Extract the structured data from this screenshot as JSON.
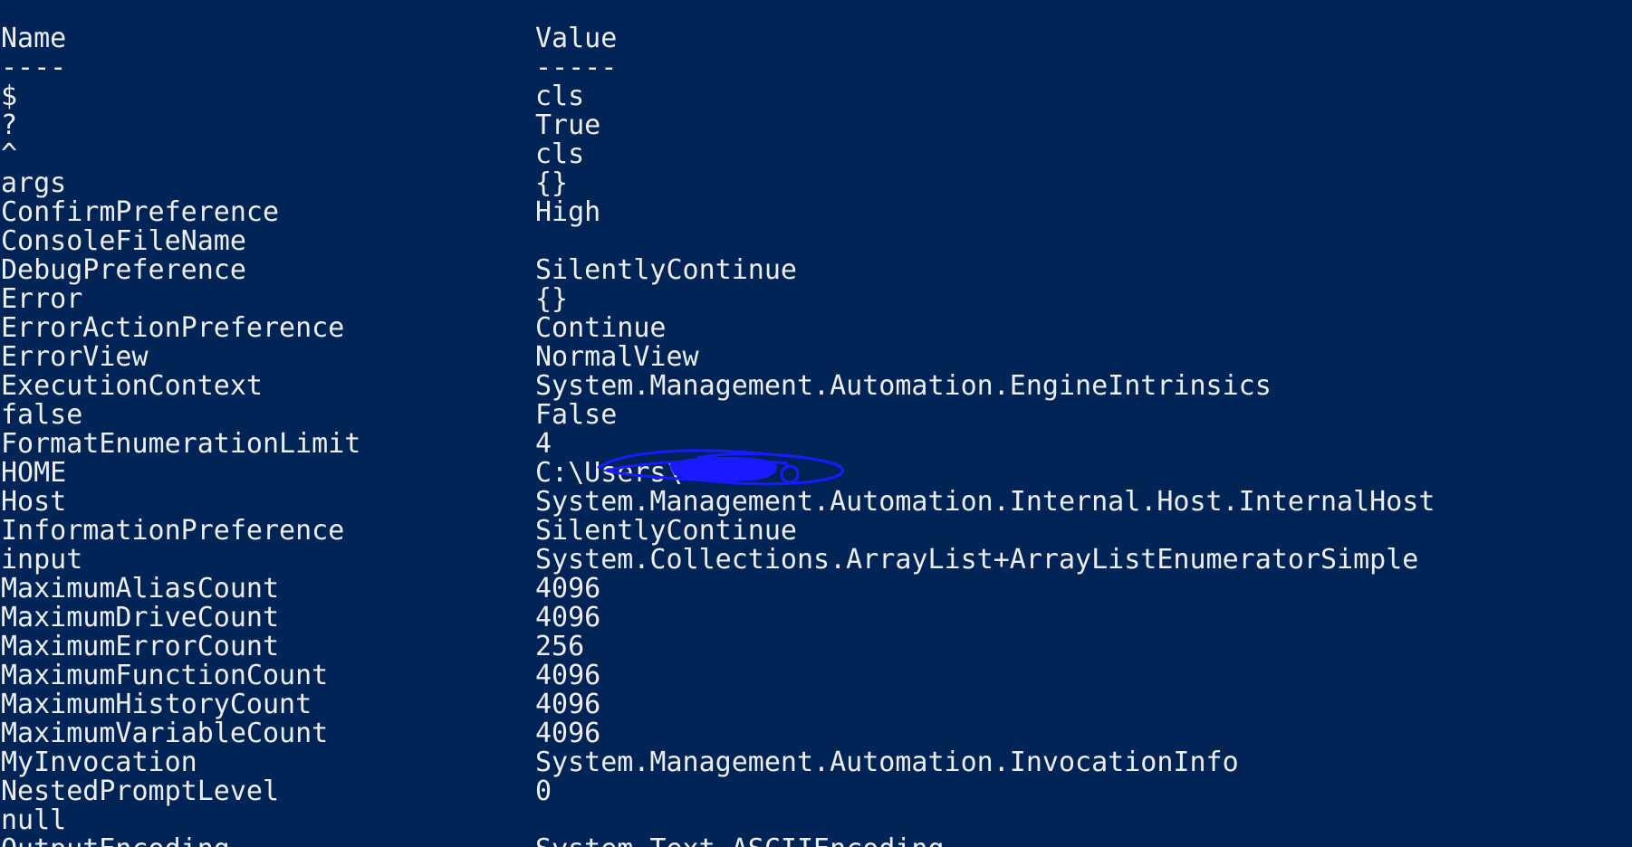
{
  "console": {
    "header": {
      "name": "Name",
      "value": "Value"
    },
    "separator": {
      "name": "----",
      "value": "-----"
    },
    "rows": [
      {
        "name": "$",
        "value": "cls"
      },
      {
        "name": "?",
        "value": "True"
      },
      {
        "name": "^",
        "value": "cls"
      },
      {
        "name": "args",
        "value": "{}"
      },
      {
        "name": "ConfirmPreference",
        "value": "High"
      },
      {
        "name": "ConsoleFileName",
        "value": ""
      },
      {
        "name": "DebugPreference",
        "value": "SilentlyContinue"
      },
      {
        "name": "Error",
        "value": "{}"
      },
      {
        "name": "ErrorActionPreference",
        "value": "Continue"
      },
      {
        "name": "ErrorView",
        "value": "NormalView"
      },
      {
        "name": "ExecutionContext",
        "value": "System.Management.Automation.EngineIntrinsics"
      },
      {
        "name": "false",
        "value": "False"
      },
      {
        "name": "FormatEnumerationLimit",
        "value": "4"
      },
      {
        "name": "HOME",
        "value": "C:\\Users\\"
      },
      {
        "name": "Host",
        "value": "System.Management.Automation.Internal.Host.InternalHost"
      },
      {
        "name": "InformationPreference",
        "value": "SilentlyContinue"
      },
      {
        "name": "input",
        "value": "System.Collections.ArrayList+ArrayListEnumeratorSimple"
      },
      {
        "name": "MaximumAliasCount",
        "value": "4096"
      },
      {
        "name": "MaximumDriveCount",
        "value": "4096"
      },
      {
        "name": "MaximumErrorCount",
        "value": "256"
      },
      {
        "name": "MaximumFunctionCount",
        "value": "4096"
      },
      {
        "name": "MaximumHistoryCount",
        "value": "4096"
      },
      {
        "name": "MaximumVariableCount",
        "value": "4096"
      },
      {
        "name": "MyInvocation",
        "value": "System.Management.Automation.InvocationInfo"
      },
      {
        "name": "NestedPromptLevel",
        "value": "0"
      },
      {
        "name": "null",
        "value": ""
      },
      {
        "name": "OutputEncoding",
        "value": "System.Text.ASCIIEncoding"
      }
    ]
  },
  "colors": {
    "background": "#012456",
    "text": "#eeedf0",
    "redaction": "#1a1aff"
  }
}
